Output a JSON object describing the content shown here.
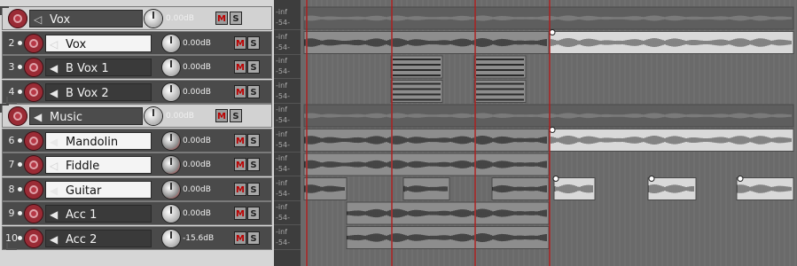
{
  "colors": {
    "record_arm": "#9a2b35",
    "mute_text": "#bb0000",
    "track_bg": "#4a4a4a",
    "selected_name_bg": "#f4f4f4",
    "arrange_bg": "#6a6a6a",
    "item_bg": "#8a8a8a",
    "waveform": "#1e1e1e",
    "playhead_line": "#b11c1c"
  },
  "tracks": [
    {
      "num": "",
      "name": "Vox",
      "volume": "0.00dB",
      "folder": true,
      "selected": false,
      "speaker_icon": "speaker-outline-icon"
    },
    {
      "num": "2",
      "name": "Vox",
      "volume": "0.00dB",
      "folder": false,
      "selected": true,
      "speaker_icon": "speaker-outline-icon"
    },
    {
      "num": "3",
      "name": "B Vox 1",
      "volume": "0.00dB",
      "folder": false,
      "selected": false,
      "speaker_icon": "speaker-icon"
    },
    {
      "num": "4",
      "name": "B Vox 2",
      "volume": "0.00dB",
      "folder": false,
      "selected": false,
      "speaker_icon": "speaker-icon"
    },
    {
      "num": "",
      "name": "Music",
      "volume": "0.00dB",
      "folder": true,
      "selected": false,
      "speaker_icon": "speaker-icon"
    },
    {
      "num": "6",
      "name": "Mandolin",
      "volume": "0.00dB",
      "folder": false,
      "selected": true,
      "speaker_icon": "speaker-icon"
    },
    {
      "num": "7",
      "name": "Fiddle",
      "volume": "0.00dB",
      "folder": false,
      "selected": true,
      "speaker_icon": "speaker-outline-icon"
    },
    {
      "num": "8",
      "name": "Guitar",
      "volume": "0.00dB",
      "folder": false,
      "selected": true,
      "speaker_icon": "speaker-icon"
    },
    {
      "num": "9",
      "name": "Acc 1",
      "volume": "0.00dB",
      "folder": false,
      "selected": false,
      "speaker_icon": "speaker-icon"
    },
    {
      "num": "10",
      "name": "Acc 2",
      "volume": "-15.6dB",
      "folder": false,
      "selected": false,
      "speaker_icon": "speaker-icon"
    }
  ],
  "buttons": {
    "mute": "M",
    "solo": "S"
  },
  "meters": {
    "top": "-inf",
    "bottom": "-54-"
  }
}
